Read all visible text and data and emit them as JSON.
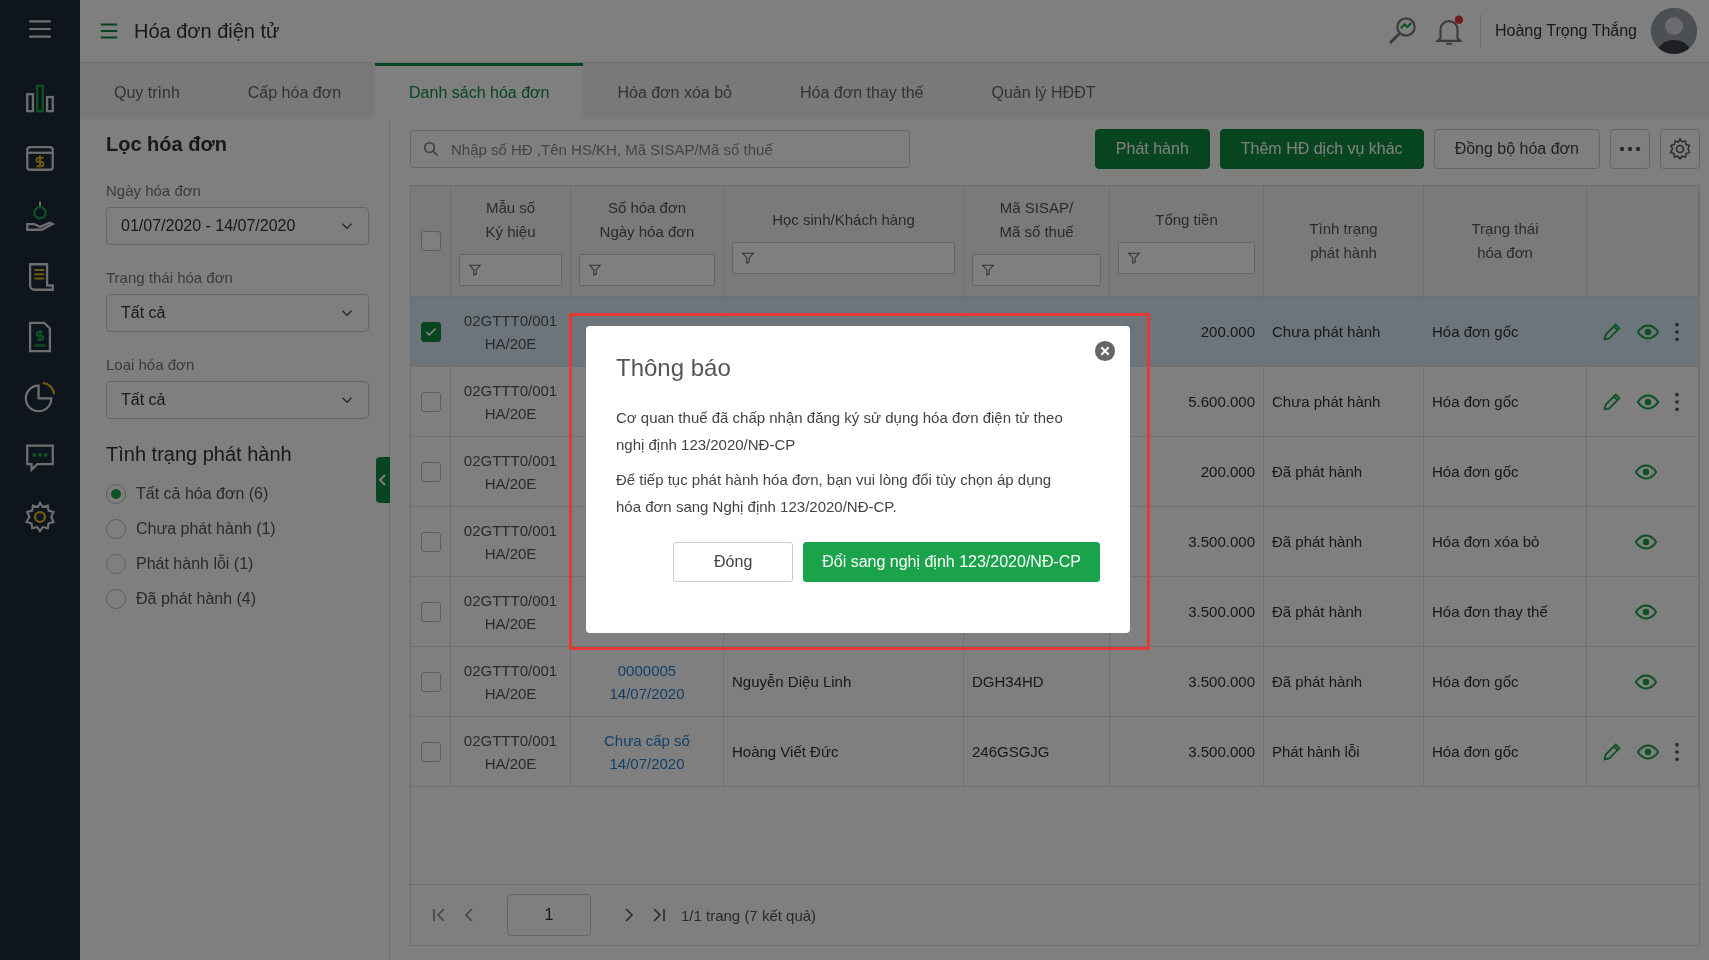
{
  "header": {
    "title": "Hóa đơn điện tử",
    "user_name": "Hoàng Trọng Thắng",
    "notification_dot": true
  },
  "tabs": [
    {
      "label": "Quy trình",
      "selected": false
    },
    {
      "label": "Cấp hóa đơn",
      "selected": false
    },
    {
      "label": "Danh sách hóa đơn",
      "selected": true
    },
    {
      "label": "Hóa đơn xóa bỏ",
      "selected": false
    },
    {
      "label": "Hóa đơn thay thế",
      "selected": false
    },
    {
      "label": "Quản lý HĐĐT",
      "selected": false
    }
  ],
  "filter_panel": {
    "title": "Lọc hóa đơn",
    "fields": [
      {
        "label": "Ngày hóa đơn",
        "value": "01/07/2020 - 14/07/2020"
      },
      {
        "label": "Trạng thái hóa đơn",
        "value": "Tất cả"
      },
      {
        "label": "Loại hóa đơn",
        "value": "Tất cả"
      }
    ],
    "status_title": "Tình trạng phát hành",
    "status_options": [
      {
        "label": "Tất cả hóa đơn (6)",
        "selected": true
      },
      {
        "label": "Chưa phát hành (1)",
        "selected": false
      },
      {
        "label": "Phát hành lỗi (1)",
        "selected": false
      },
      {
        "label": "Đã phát hành (4)",
        "selected": false
      }
    ]
  },
  "toolbar": {
    "search_placeholder": "Nhập số HĐ ,Tên HS/KH, Mã SISAP/Mã số thuế",
    "buttons": [
      {
        "label": "Phát hành",
        "kind": "primary"
      },
      {
        "label": "Thêm HĐ dịch vụ khác",
        "kind": "primary"
      },
      {
        "label": "Đồng bộ hóa đơn",
        "kind": "secondary"
      }
    ]
  },
  "table": {
    "select_all_checked": false,
    "columns": [
      {
        "lines": [
          "Mẫu số",
          "Ký hiệu"
        ],
        "filter": true
      },
      {
        "lines": [
          "Số hóa đơn",
          "Ngày hóa đơn"
        ],
        "filter": true
      },
      {
        "lines": [
          "Học sinh/Khách hàng"
        ],
        "filter": true
      },
      {
        "lines": [
          "Mã SISAP/",
          "Mã số thuế"
        ],
        "filter": true
      },
      {
        "lines": [
          "Tổng tiền"
        ],
        "filter": true
      },
      {
        "lines": [
          "Tình trạng",
          "phát hành"
        ],
        "filter": false
      },
      {
        "lines": [
          "Trạng thái",
          "hóa đơn"
        ],
        "filter": false
      }
    ],
    "rows": [
      {
        "checked": true,
        "selected": true,
        "template": "02GTTT0/001",
        "series": "HA/20E",
        "total": "200.000",
        "issue_status": "Chưa phát hành",
        "invoice_status": "Hóa đơn gốc",
        "editable": true,
        "more": true
      },
      {
        "checked": false,
        "selected": false,
        "template": "02GTTT0/001",
        "series": "HA/20E",
        "total": "5.600.000",
        "issue_status": "Chưa phát hành",
        "invoice_status": "Hóa đơn gốc",
        "editable": true,
        "more": true
      },
      {
        "checked": false,
        "selected": false,
        "template": "02GTTT0/001",
        "series": "HA/20E",
        "total": "200.000",
        "issue_status": "Đã phát hành",
        "invoice_status": "Hóa đơn gốc",
        "editable": false,
        "more": false
      },
      {
        "checked": false,
        "selected": false,
        "template": "02GTTT0/001",
        "series": "HA/20E",
        "total": "3.500.000",
        "issue_status": "Đã phát hành",
        "invoice_status": "Hóa đơn xóa bỏ",
        "editable": false,
        "more": false
      },
      {
        "checked": false,
        "selected": false,
        "template": "02GTTT0/001",
        "series": "HA/20E",
        "total": "3.500.000",
        "issue_status": "Đã phát hành",
        "invoice_status": "Hóa đơn thay thế",
        "editable": false,
        "more": false
      },
      {
        "checked": false,
        "selected": false,
        "template": "02GTTT0/001",
        "series": "HA/20E",
        "number": "0000005",
        "date": "14/07/2020",
        "customer": "Nguyễn Diệu Linh",
        "tax_code": "DGH34HD",
        "total": "3.500.000",
        "issue_status": "Đã phát hành",
        "invoice_status": "Hóa đơn gốc",
        "editable": false,
        "more": false
      },
      {
        "checked": false,
        "selected": false,
        "template": "02GTTT0/001",
        "series": "HA/20E",
        "number": "Chưa cấp số",
        "date": "14/07/2020",
        "customer": "Hoàng Viết Đức",
        "tax_code": "246GSGJG",
        "total": "3.500.000",
        "issue_status": "Phát hành lỗi",
        "invoice_status": "Hóa đơn gốc",
        "editable": true,
        "more": true
      }
    ]
  },
  "pagination": {
    "page": "1",
    "summary": "1/1 trang (7 kết quả)"
  },
  "dialog": {
    "title": "Thông báo",
    "paragraphs": [
      "Cơ quan thuế đã chấp nhận đăng ký sử dụng hóa đơn điện tử theo nghị định 123/2020/NĐ-CP",
      "Để tiếp tục phát hành hóa đơn, bạn vui lòng đổi tùy chọn áp dụng hóa đơn sang Nghị định 123/2020/NĐ-CP."
    ],
    "buttons": [
      {
        "label": "Đóng",
        "kind": "secondary"
      },
      {
        "label": "Đổi sang nghị định 123/2020/NĐ-CP",
        "kind": "primary"
      }
    ]
  }
}
